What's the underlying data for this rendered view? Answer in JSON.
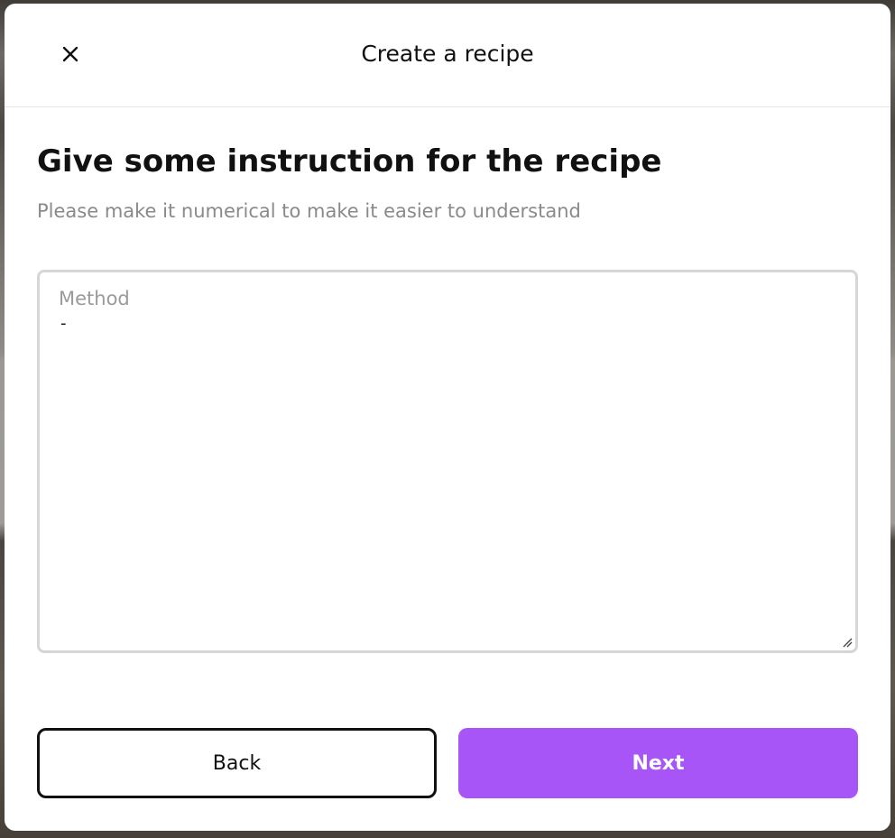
{
  "header": {
    "title": "Create a recipe",
    "close_icon": "close-icon"
  },
  "step": {
    "heading": "Give some instruction for the recipe",
    "subtitle": "Please make it numerical to make it easier to understand"
  },
  "method": {
    "label": "Method",
    "value": "-"
  },
  "actions": {
    "back_label": "Back",
    "next_label": "Next"
  },
  "colors": {
    "accent": "#a855f7",
    "text": "#111111",
    "muted": "#8a8a8a",
    "border": "#d6d6d6"
  }
}
